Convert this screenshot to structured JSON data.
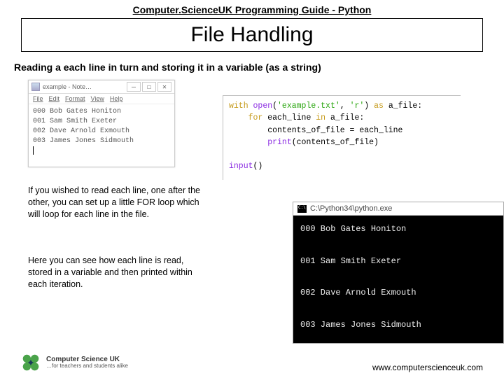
{
  "header": {
    "top": "Computer.ScienceUK Programming Guide - Python",
    "title": "File Handling",
    "sub": "Reading a each line in turn and storing it in a variable (as a string)"
  },
  "notepad": {
    "title": "example - Note…",
    "menu": {
      "file": "File",
      "edit": "Edit",
      "format": "Format",
      "view": "View",
      "help": "Help"
    },
    "lines": [
      "000 Bob Gates Honiton",
      "001 Sam Smith Exeter",
      "002 Dave Arnold Exmouth",
      "003 James Jones Sidmouth"
    ],
    "min": "—",
    "max": "☐",
    "close": "✕"
  },
  "para1": "If you wished to read each line, one after the other, you can set up a little FOR loop which will loop for each line in the file.",
  "para2": "Here you can see how each line is read, stored in a variable and then printed within each iteration.",
  "code": {
    "l1": {
      "with": "with",
      "open": "open",
      "arg1": "'example.txt'",
      "comma": ", ",
      "arg2": "'r'",
      "as": "as",
      "var": "a_file:"
    },
    "l2": {
      "for": "for",
      "rest": "each_line ",
      "in": "in",
      "rest2": " a_file:"
    },
    "l3": "contents_of_file = each_line",
    "l4": {
      "print": "print",
      "arg": "(contents_of_file)"
    },
    "l5": {
      "input": "input",
      "p": "()"
    }
  },
  "console": {
    "title": "C:\\Python34\\python.exe",
    "lines": [
      "000 Bob Gates Honiton",
      "001 Sam Smith Exeter",
      "002 Dave Arnold Exmouth",
      "003 James Jones Sidmouth"
    ]
  },
  "footer": {
    "brand": "Computer Science UK",
    "tag": "…for teachers and students alike",
    "url": "www.computerscienceuk.com"
  }
}
